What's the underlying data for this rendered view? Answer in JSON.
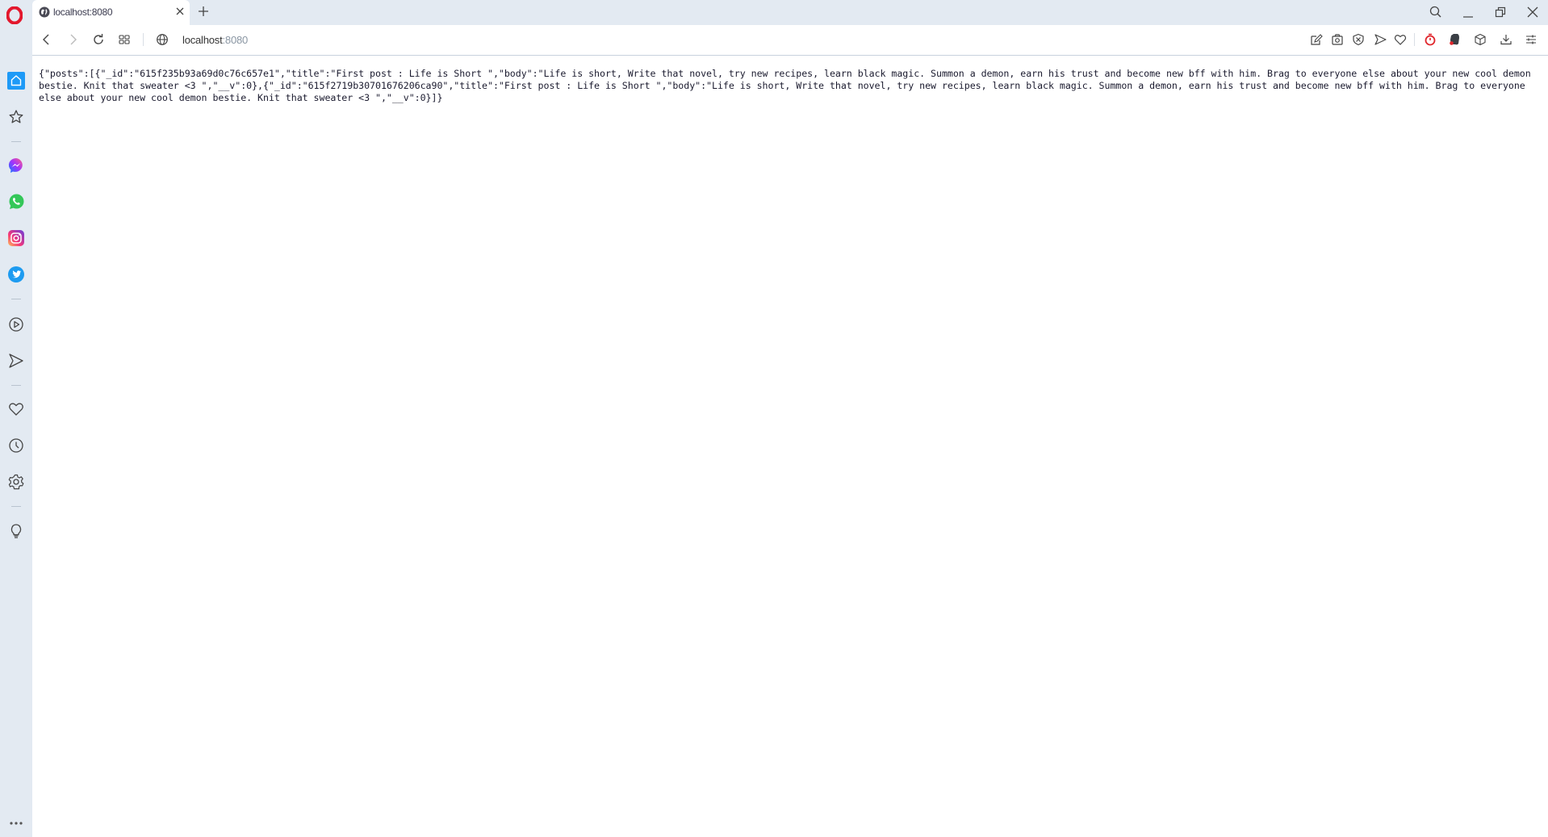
{
  "browser": {
    "name": "Opera",
    "tab": {
      "title": "localhost:8080",
      "favicon": "globe-icon"
    },
    "new_tab_label": "+",
    "address": {
      "host": "localhost",
      "port": ":8080"
    },
    "window_controls": [
      "search-icon",
      "minimize-icon",
      "restore-icon",
      "close-icon"
    ],
    "nav_buttons": [
      "back-icon",
      "forward-icon",
      "reload-icon",
      "tab-grid-icon"
    ],
    "toolbar_icons": [
      "snapshot-edit-icon",
      "camera-icon",
      "adblock-shield-icon",
      "send-icon",
      "heart-icon",
      "timer-icon",
      "evernote-icon",
      "cube-icon",
      "download-icon",
      "easy-setup-icon"
    ],
    "sidebar_items": [
      "home-icon",
      "star-icon",
      "messenger-icon",
      "whatsapp-icon",
      "instagram-icon",
      "twitter-icon",
      "player-icon",
      "send-icon",
      "heart-icon",
      "history-icon",
      "settings-icon",
      "lightbulb-icon",
      "more-icon"
    ]
  },
  "colors": {
    "chrome_bg": "#e3eaf2",
    "home_accent": "#1e9af7",
    "opera_red": "#e3182d",
    "timer_red": "#e0262c"
  },
  "page": {
    "raw_json": "{\"posts\":[{\"_id\":\"615f235b93a69d0c76c657e1\",\"title\":\"First post : Life is Short \",\"body\":\"Life is short, Write that novel, try new recipes, learn black magic. Summon a demon, earn his trust and become new bff with him. Brag to everyone else about your new cool demon bestie. Knit that sweater <3 \",\"__v\":0},{\"_id\":\"615f2719b30701676206ca90\",\"title\":\"First post : Life is Short \",\"body\":\"Life is short, Write that novel, try new recipes, learn black magic. Summon a demon, earn his trust and become new bff with him. Brag to everyone else about your new cool demon bestie. Knit that sweater <3 \",\"__v\":0}]}",
    "posts": [
      {
        "_id": "615f235b93a69d0c76c657e1",
        "title": "First post : Life is Short ",
        "body": "Life is short, Write that novel, try new recipes, learn black magic. Summon a demon, earn his trust and become new bff with him. Brag to everyone else about your new cool demon bestie. Knit that sweater <3 ",
        "__v": 0
      },
      {
        "_id": "615f2719b30701676206ca90",
        "title": "First post : Life is Short ",
        "body": "Life is short, Write that novel, try new recipes, learn black magic. Summon a demon, earn his trust and become new bff with him. Brag to everyone else about your new cool demon bestie. Knit that sweater <3 ",
        "__v": 0
      }
    ]
  }
}
